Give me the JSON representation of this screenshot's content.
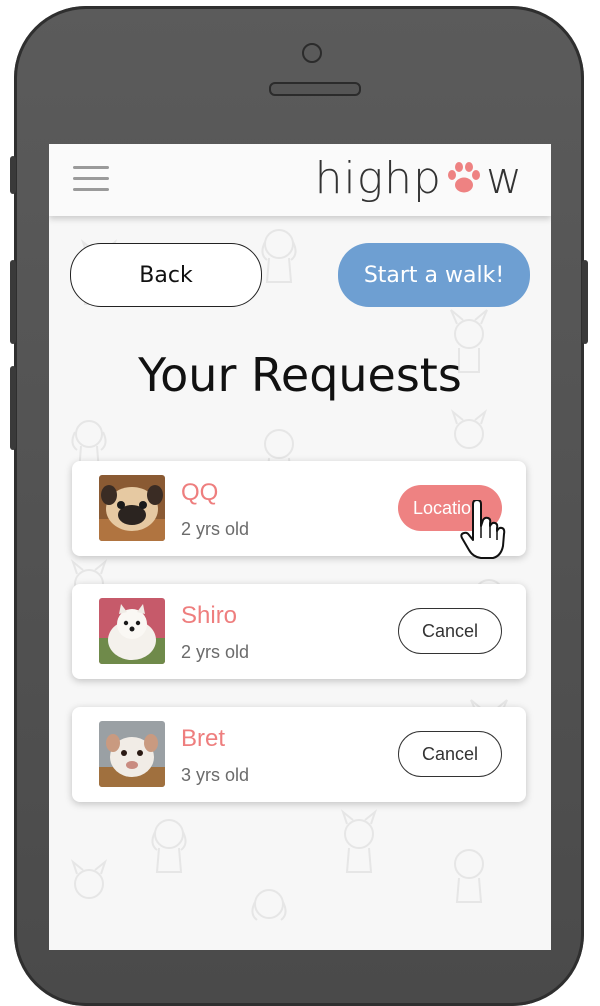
{
  "app": {
    "logo_text_left": "highp",
    "logo_text_right": "w",
    "accent_color": "#ee8282",
    "primary_button_color": "#6e9fd2"
  },
  "header": {
    "menu_icon": "hamburger-menu-icon"
  },
  "actions": {
    "back_label": "Back",
    "start_walk_label": "Start a walk!"
  },
  "page": {
    "title": "Your Requests"
  },
  "requests": [
    {
      "name": "QQ",
      "age": "2 yrs old",
      "action_label": "Location",
      "photo": "pug-photo"
    },
    {
      "name": "Shiro",
      "age": "2 yrs old",
      "action_label": "Cancel",
      "photo": "samoyed-puppy-photo"
    },
    {
      "name": "Bret",
      "age": "3 yrs old",
      "action_label": "Cancel",
      "photo": "pitbull-photo"
    }
  ]
}
